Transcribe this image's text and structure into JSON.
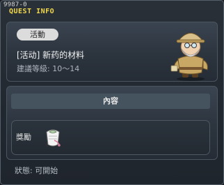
{
  "window": {
    "quest_id": "9987-0",
    "title": "QUEST INFO"
  },
  "quest": {
    "category": "活動",
    "name": "[活动] 新药的材料",
    "level": "建議等級: 10～14"
  },
  "content": {
    "header": "內容",
    "reward_label": "獎勵",
    "reward_item_icon": "white-scroll-item-icon"
  },
  "footer": {
    "status_label": "狀態: ",
    "status_value": "可開始"
  },
  "colors": {
    "title": "#f0d84a",
    "badge_bg": "#dcdcdc",
    "content_header_bg": "#45535f"
  }
}
